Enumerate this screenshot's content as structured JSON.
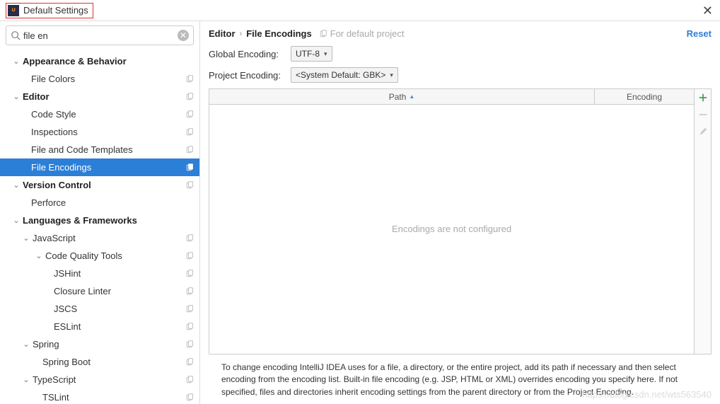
{
  "window": {
    "title": "Default Settings"
  },
  "search": {
    "value": "file en"
  },
  "sidebar": {
    "items": [
      {
        "label": "Appearance & Behavior",
        "bold": true,
        "expandable": true
      },
      {
        "label": "File Colors",
        "indent": "leaf0",
        "copy": true
      },
      {
        "label": "Editor",
        "bold": true,
        "expandable": true,
        "copy": true
      },
      {
        "label": "Code Style",
        "indent": "leaf0",
        "copy": true
      },
      {
        "label": "Inspections",
        "indent": "leaf0",
        "copy": true
      },
      {
        "label": "File and Code Templates",
        "indent": "leaf0",
        "copy": true
      },
      {
        "label": "File Encodings",
        "indent": "leaf0",
        "copy": true,
        "selected": true
      },
      {
        "label": "Version Control",
        "bold": true,
        "expandable": true,
        "copy": true
      },
      {
        "label": "Perforce",
        "indent": "leaf0"
      },
      {
        "label": "Languages & Frameworks",
        "bold": true,
        "expandable": true
      },
      {
        "label": "JavaScript",
        "indent": 1,
        "expandable": true,
        "copy": true
      },
      {
        "label": "Code Quality Tools",
        "indent": 2,
        "expandable": true,
        "copy": true
      },
      {
        "label": "JSHint",
        "indent": "leaf2",
        "copy": true
      },
      {
        "label": "Closure Linter",
        "indent": "leaf2",
        "copy": true
      },
      {
        "label": "JSCS",
        "indent": "leaf2",
        "copy": true
      },
      {
        "label": "ESLint",
        "indent": "leaf2",
        "copy": true
      },
      {
        "label": "Spring",
        "indent": 1,
        "expandable": true,
        "copy": true
      },
      {
        "label": "Spring Boot",
        "indent": "leaf1",
        "copy": true
      },
      {
        "label": "TypeScript",
        "indent": 1,
        "expandable": true,
        "copy": true
      },
      {
        "label": "TSLint",
        "indent": "leaf1",
        "copy": true
      }
    ]
  },
  "main": {
    "breadcrumb": [
      "Editor",
      "File Encodings"
    ],
    "note": "For default project",
    "reset": "Reset",
    "globalEncodingLabel": "Global Encoding:",
    "globalEncodingValue": "UTF-8",
    "projectEncodingLabel": "Project Encoding:",
    "projectEncodingValue": "<System Default: GBK>",
    "table": {
      "pathHeader": "Path",
      "encodingHeader": "Encoding",
      "emptyText": "Encodings are not configured"
    },
    "description": "To change encoding IntelliJ IDEA uses for a file, a directory, or the entire project, add its path if necessary and then select encoding from the encoding list. Built-in file encoding (e.g. JSP, HTML or XML) overrides encoding you specify here. If not specified, files and directories inherit encoding settings from the parent directory or from the Project Encoding."
  },
  "watermark": "https://blog.csdn.net/wts563540"
}
